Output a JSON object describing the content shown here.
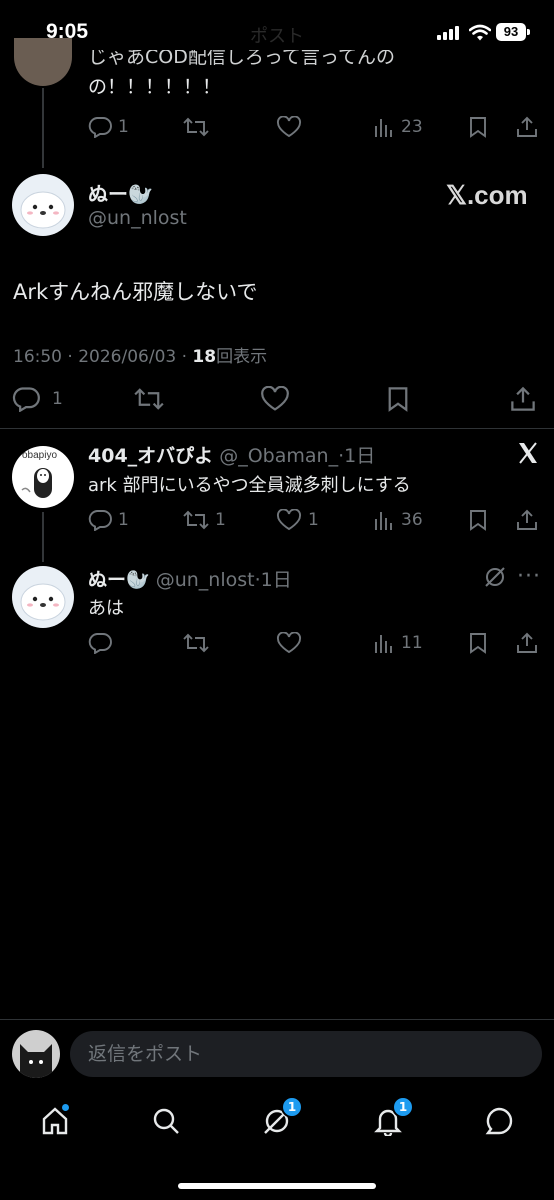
{
  "status": {
    "time": "9:05",
    "battery": "93",
    "ghost_title": "ポスト"
  },
  "top_tweet": {
    "text_line1": "じゃあCOD配信しろって言ってんの",
    "text_line2": "の！！！！！！",
    "replies": "1",
    "views": "23"
  },
  "main_tweet": {
    "display_name": "ぬー🦭",
    "handle": "@un_nlost",
    "watermark": "𝕏.com",
    "text": "Arkすんねん邪魔しないで",
    "time": "16:50",
    "date": "2026/06/03",
    "sep": "·",
    "views_count": "18",
    "views_label": "回表示",
    "replies": "1"
  },
  "reply1": {
    "display_name": "404_オバぴよ",
    "handle": "@_Obaman_",
    "age": "1日",
    "text": "ark 部門にいるやつ全員滅多刺しにする",
    "replies": "1",
    "reposts": "1",
    "likes": "1",
    "views": "36",
    "avatar_text": "obapiyo"
  },
  "reply2": {
    "display_name": "ぬー🦭",
    "handle": "@un_nlost",
    "age": "1日",
    "text": "あは",
    "views": "11"
  },
  "composer": {
    "placeholder": "返信をポスト"
  },
  "tabbar": {
    "grok_badge": "1",
    "notifications_badge": "1"
  },
  "colors": {
    "background": "#000000",
    "accent": "#1d9bf0",
    "muted": "#71767b",
    "text": "#e7e9ea"
  }
}
